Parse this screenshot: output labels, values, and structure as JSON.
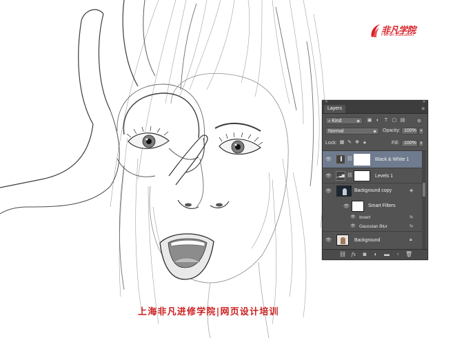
{
  "logo": {
    "main": "非凡学院",
    "sub": "FeiFan Education"
  },
  "watermark": "上海非凡进修学院|网页设计培训",
  "layers_panel": {
    "tab_label": "Layers",
    "filter": {
      "kind_label": "Kind",
      "icons": [
        "image-filter-icon",
        "adjustment-filter-icon",
        "type-filter-icon",
        "shape-filter-icon",
        "smart-object-filter-icon",
        "filter-toggle-icon"
      ]
    },
    "blend_mode": "Normal",
    "opacity_label": "Opacity:",
    "opacity_value": "100%",
    "lock_label": "Lock:",
    "fill_label": "Fill:",
    "fill_value": "100%",
    "layers": [
      {
        "name": "Black & White 1",
        "selected": true,
        "type": "adjustment-black-white"
      },
      {
        "name": "Levels 1",
        "selected": false,
        "type": "adjustment-levels"
      },
      {
        "name": "Background copy",
        "selected": false,
        "type": "smart-object"
      },
      {
        "name": "Smart Filters",
        "selected": false,
        "type": "smart-filters"
      },
      {
        "name": "Invert",
        "selected": false,
        "type": "filter"
      },
      {
        "name": "Gaussian Blur",
        "selected": false,
        "type": "filter"
      },
      {
        "name": "Background",
        "selected": false,
        "type": "background",
        "locked": true
      }
    ],
    "footer_icons": [
      "link-icon",
      "fx-icon",
      "mask-icon",
      "adjustment-icon",
      "group-icon",
      "new-layer-icon",
      "trash-icon"
    ]
  },
  "colors": {
    "panel_bg": "#535353",
    "selected_layer": "#6f7b8e",
    "brand_red": "#d8222a"
  }
}
